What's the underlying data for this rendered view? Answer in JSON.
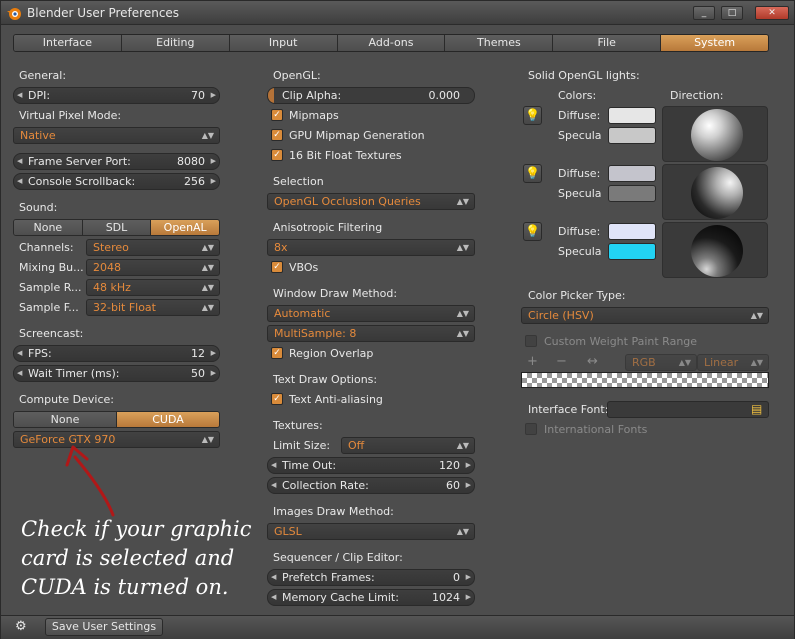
{
  "window": {
    "title": "Blender User Preferences",
    "min": "_",
    "max": "□",
    "close": "✕"
  },
  "tabs": [
    "Interface",
    "Editing",
    "Input",
    "Add-ons",
    "Themes",
    "File",
    "System"
  ],
  "active_tab": "System",
  "col1": {
    "general": "General:",
    "dpi": {
      "label": "DPI:",
      "value": "70"
    },
    "virtual_pixel": "Virtual Pixel Mode:",
    "virtual_pixel_value": "Native",
    "frame_server": {
      "label": "Frame Server Port:",
      "value": "8080"
    },
    "console": {
      "label": "Console Scrollback:",
      "value": "256"
    },
    "sound": "Sound:",
    "sound_opts": [
      "None",
      "SDL",
      "OpenAL"
    ],
    "sound_active": "OpenAL",
    "channels": {
      "label": "Channels:",
      "value": "Stereo"
    },
    "mixing": {
      "label": "Mixing Bu...",
      "value": "2048"
    },
    "sample_rate": {
      "label": "Sample R...",
      "value": "48 kHz"
    },
    "sample_fmt": {
      "label": "Sample F...",
      "value": "32-bit Float"
    },
    "screencast": "Screencast:",
    "fps": {
      "label": "FPS:",
      "value": "12"
    },
    "wait": {
      "label": "Wait Timer (ms):",
      "value": "50"
    },
    "compute": "Compute Device:",
    "compute_opts": [
      "None",
      "CUDA"
    ],
    "compute_active": "CUDA",
    "gpu": "GeForce GTX 970"
  },
  "col2": {
    "opengl": "OpenGL:",
    "clip_alpha": {
      "label": "Clip Alpha:",
      "value": "0.000"
    },
    "mipmaps": "Mipmaps",
    "gpu_mipmap": "GPU Mipmap Generation",
    "float_tex": "16 Bit Float Textures",
    "selection": "Selection",
    "selection_value": "OpenGL Occlusion Queries",
    "aniso": "Anisotropic Filtering",
    "aniso_value": "8x",
    "vbos": "VBOs",
    "window_draw": "Window Draw Method:",
    "window_draw_value": "Automatic",
    "multisample": "MultiSample: 8",
    "region_overlap": "Region Overlap",
    "text_draw": "Text Draw Options:",
    "text_aa": "Text Anti-aliasing",
    "textures": "Textures:",
    "limit_size": {
      "label": "Limit Size:",
      "value": "Off"
    },
    "time_out": {
      "label": "Time Out:",
      "value": "120"
    },
    "collection": {
      "label": "Collection Rate:",
      "value": "60"
    },
    "images_draw": "Images Draw Method:",
    "images_draw_value": "GLSL",
    "sequencer": "Sequencer / Clip Editor:",
    "prefetch": {
      "label": "Prefetch Frames:",
      "value": "0"
    },
    "mem_cache": {
      "label": "Memory Cache Limit:",
      "value": "1024"
    }
  },
  "col3": {
    "solid_lights": "Solid OpenGL lights:",
    "colors": "Colors:",
    "direction": "Direction:",
    "lights": [
      {
        "diffuse": "Diffuse:",
        "specular": "Specula",
        "diffuse_color": "#e6e6e6",
        "specular_color": "#c8c8c8"
      },
      {
        "diffuse": "Diffuse:",
        "specular": "Specula",
        "diffuse_color": "#c4c4cc",
        "specular_color": "#7a7a7a"
      },
      {
        "diffuse": "Diffuse:",
        "specular": "Specula",
        "diffuse_color": "#e0e4f8",
        "specular_color": "#22d3f4"
      }
    ],
    "color_picker": "Color Picker Type:",
    "color_picker_value": "Circle (HSV)",
    "weight_range": "Custom Weight Paint Range",
    "ramp_rgb": "RGB",
    "ramp_linear": "Linear",
    "ramp_add": "+",
    "ramp_remove": "−",
    "ramp_flip": "↔",
    "interface_font": "Interface Font:",
    "intl_fonts": "International Fonts"
  },
  "annotation": {
    "line1": "Check if your graphic",
    "line2": "card is selected and",
    "line3": "CUDA is turned on."
  },
  "footer": {
    "save": "Save User Settings"
  }
}
